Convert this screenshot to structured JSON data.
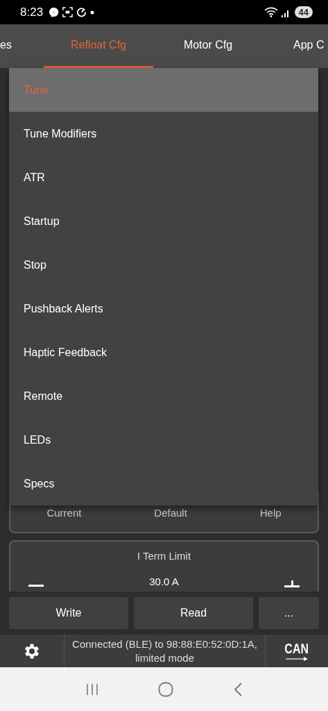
{
  "status_bar": {
    "time": "8:23",
    "battery": "44"
  },
  "tabs": [
    {
      "label": "es",
      "selected": false
    },
    {
      "label": "Refloat Cfg",
      "selected": true
    },
    {
      "label": "Motor Cfg",
      "selected": false
    },
    {
      "label": "App C",
      "selected": false
    }
  ],
  "menu": [
    {
      "label": "Tune",
      "selected": true
    },
    {
      "label": "Tune Modifiers",
      "selected": false
    },
    {
      "label": "ATR",
      "selected": false
    },
    {
      "label": "Startup",
      "selected": false
    },
    {
      "label": "Stop",
      "selected": false
    },
    {
      "label": "Pushback Alerts",
      "selected": false
    },
    {
      "label": "Haptic Feedback",
      "selected": false
    },
    {
      "label": "Remote",
      "selected": false
    },
    {
      "label": "LEDs",
      "selected": false
    },
    {
      "label": "Specs",
      "selected": false
    }
  ],
  "param_card": {
    "buttons": [
      "Current",
      "Default",
      "Help"
    ]
  },
  "i_term_card": {
    "title": "I Term Limit",
    "value": "30.0 A"
  },
  "actions": [
    "Write",
    "Read",
    "..."
  ],
  "bottom_bar": {
    "status": "Connected (BLE) to 98:88:E0:52:0D:1A, limited mode",
    "can_label": "CAN"
  }
}
